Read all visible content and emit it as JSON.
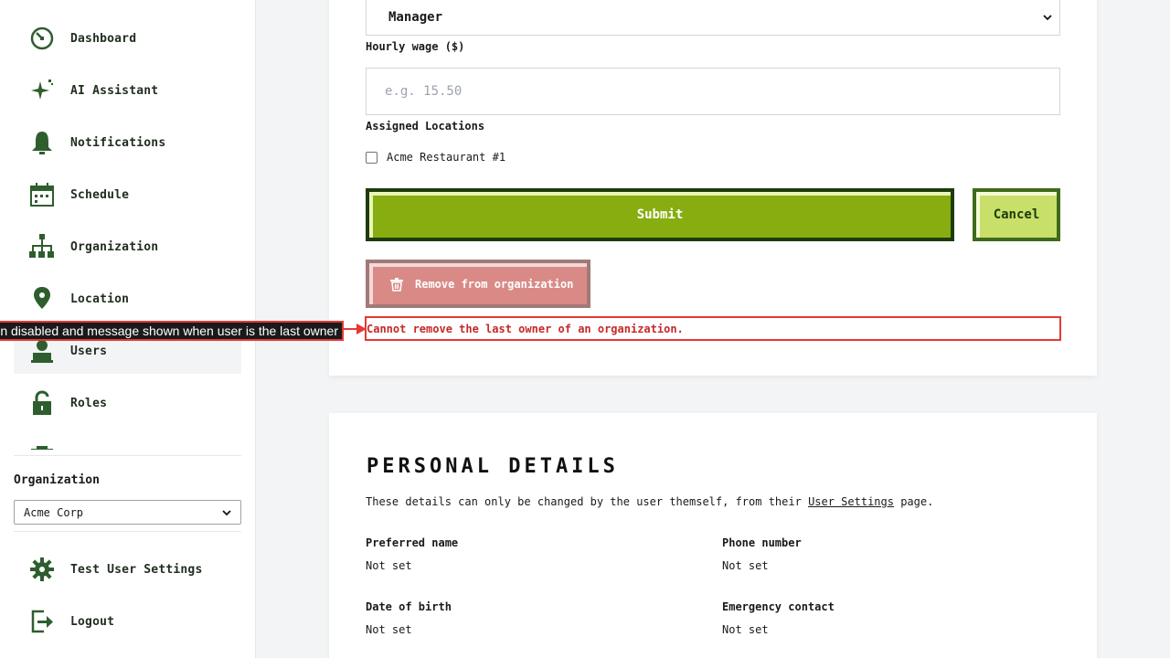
{
  "sidebar": {
    "items": [
      {
        "label": "Dashboard",
        "icon": "dashboard-icon"
      },
      {
        "label": "AI Assistant",
        "icon": "sparkle-icon"
      },
      {
        "label": "Notifications",
        "icon": "bell-icon"
      },
      {
        "label": "Schedule",
        "icon": "calendar-icon"
      },
      {
        "label": "Organization",
        "icon": "org-chart-icon"
      },
      {
        "label": "Location",
        "icon": "location-pin-icon"
      },
      {
        "label": "Users",
        "icon": "user-icon"
      },
      {
        "label": "Roles",
        "icon": "lock-icon"
      }
    ],
    "organization_label": "Organization",
    "organization_selected": "Acme Corp",
    "bottom_items": [
      {
        "label": "Test User Settings",
        "icon": "gear-icon"
      },
      {
        "label": "Logout",
        "icon": "logout-icon"
      }
    ]
  },
  "form": {
    "role_selected": "Manager",
    "wage_label": "Hourly wage ($)",
    "wage_placeholder": "e.g. 15.50",
    "locations_label": "Assigned Locations",
    "location_option": "Acme Restaurant #1",
    "submit_label": "Submit",
    "cancel_label": "Cancel",
    "remove_label": "Remove from organization",
    "error_message": "Cannot remove the last owner of an organization."
  },
  "annotation": {
    "text": "on disabled and message shown when user is the last owner"
  },
  "personal_details": {
    "title": "PERSONAL DETAILS",
    "description_prefix": "These details can only be changed by the user themself, from their ",
    "description_link": "User Settings",
    "description_suffix": " page.",
    "fields": [
      {
        "label": "Preferred name",
        "value": "Not set"
      },
      {
        "label": "Phone number",
        "value": "Not set"
      },
      {
        "label": "Date of birth",
        "value": "Not set"
      },
      {
        "label": "Emergency contact",
        "value": "Not set"
      }
    ]
  },
  "colors": {
    "accent_green": "#88ad10",
    "dark_green": "#1d3b0b",
    "icon_green": "#2e5e2e",
    "danger_red": "#e53935"
  }
}
